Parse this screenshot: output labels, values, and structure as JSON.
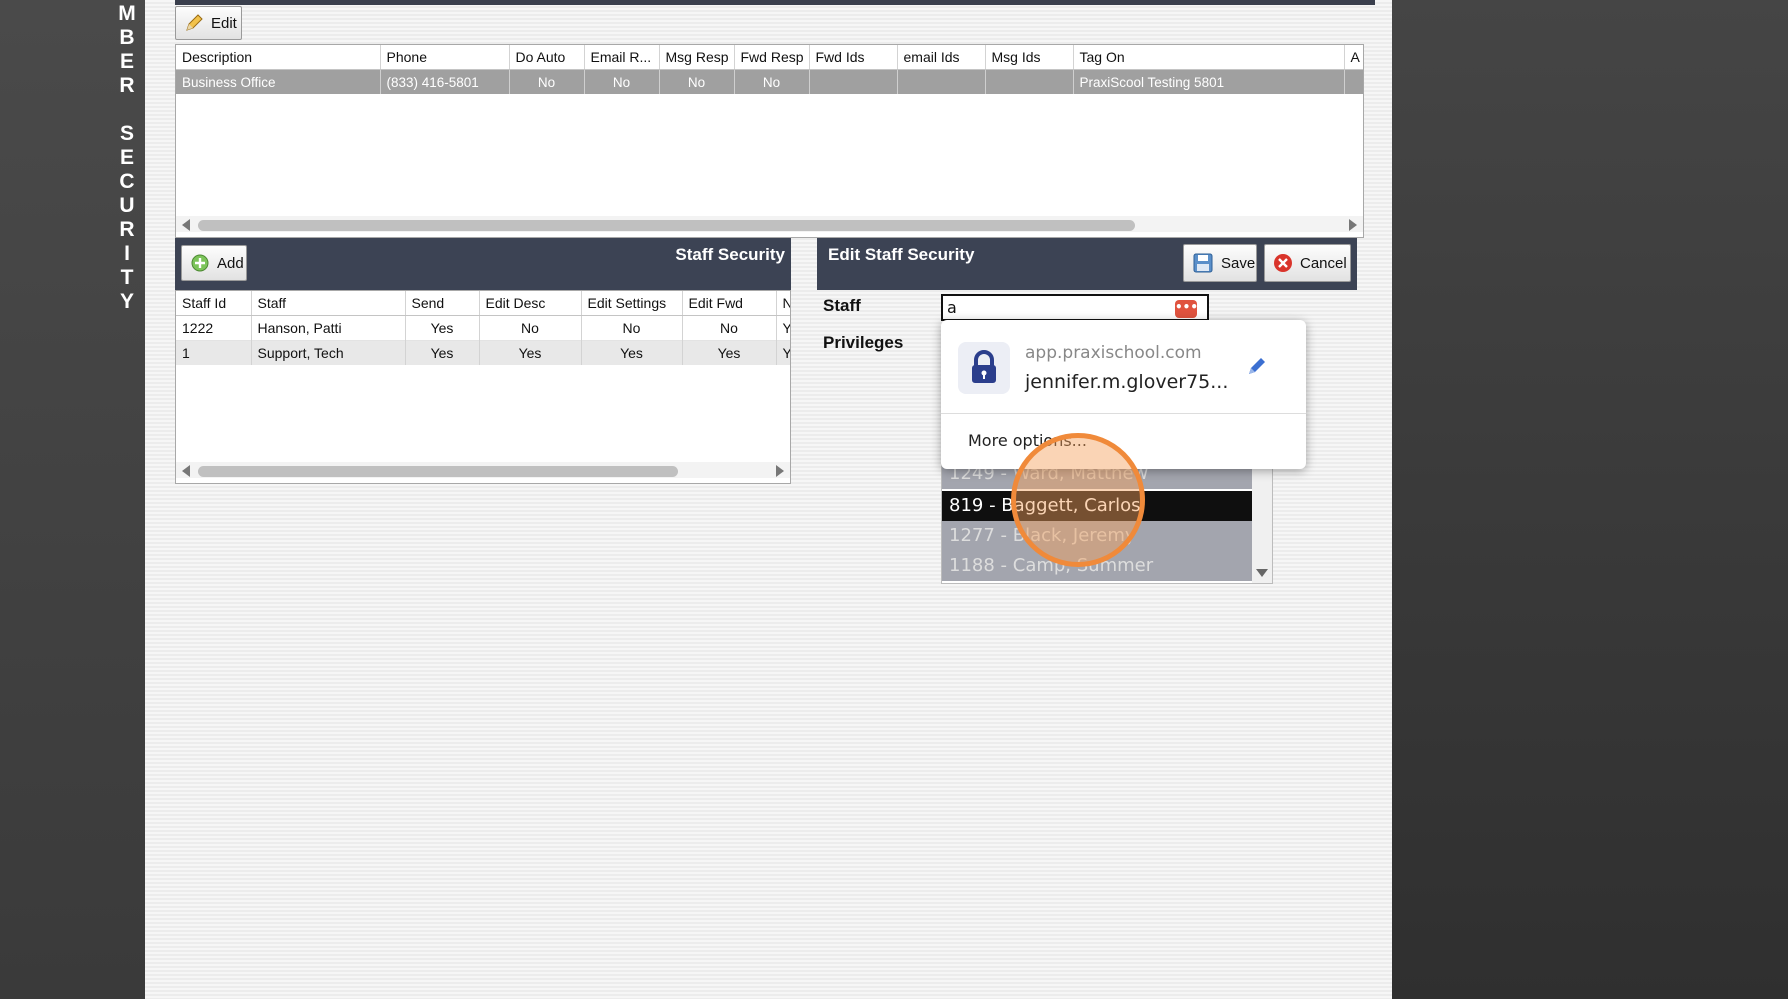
{
  "sidebar": {
    "vertical_title_letters": [
      "M",
      "B",
      "E",
      "R",
      "",
      "S",
      "E",
      "C",
      "U",
      "R",
      "I",
      "T",
      "Y"
    ]
  },
  "toolbar": {
    "edit_label": "Edit"
  },
  "main_grid": {
    "columns": [
      "Description",
      "Phone",
      "Do Auto",
      "Email R...",
      "Msg Resp",
      "Fwd Resp",
      "Fwd Ids",
      "email Ids",
      "Msg Ids",
      "Tag On",
      "A"
    ],
    "rows": [
      [
        "Business Office",
        "(833) 416-5801",
        "No",
        "No",
        "No",
        "No",
        "",
        "",
        "",
        "PraxiScool Testing 5801",
        ""
      ]
    ]
  },
  "staff_security": {
    "title": "Staff Security",
    "add_label": "Add",
    "columns": [
      "Staff Id",
      "Staff",
      "Send",
      "Edit Desc",
      "Edit Settings",
      "Edit Fwd",
      "No"
    ],
    "rows": [
      [
        "1222",
        "Hanson, Patti",
        "Yes",
        "No",
        "No",
        "No",
        "Ye"
      ],
      [
        "1",
        "Support, Tech",
        "Yes",
        "Yes",
        "Yes",
        "Yes",
        "Ye"
      ]
    ]
  },
  "edit_staff": {
    "title": "Edit Staff Security",
    "save_label": "Save",
    "cancel_label": "Cancel",
    "staff_label": "Staff",
    "privileges_label": "Privileges",
    "staff_value": "a"
  },
  "autofill": {
    "site": "app.praxischool.com",
    "username": "jennifer.m.glover75...",
    "more_options": "More options..."
  },
  "staff_list": {
    "items": [
      "1249 - Ward, Matthew",
      "819 - Baggett, Carlos",
      "1277 - Black, Jeremy",
      "1188 - Camp, Summer"
    ],
    "selected_index": 1
  },
  "colors": {
    "header_bg": "#3c4354",
    "selected_row": "#a0a0a0",
    "cursor_highlight": "#f08a3a",
    "cancel_red": "#d9342b"
  }
}
